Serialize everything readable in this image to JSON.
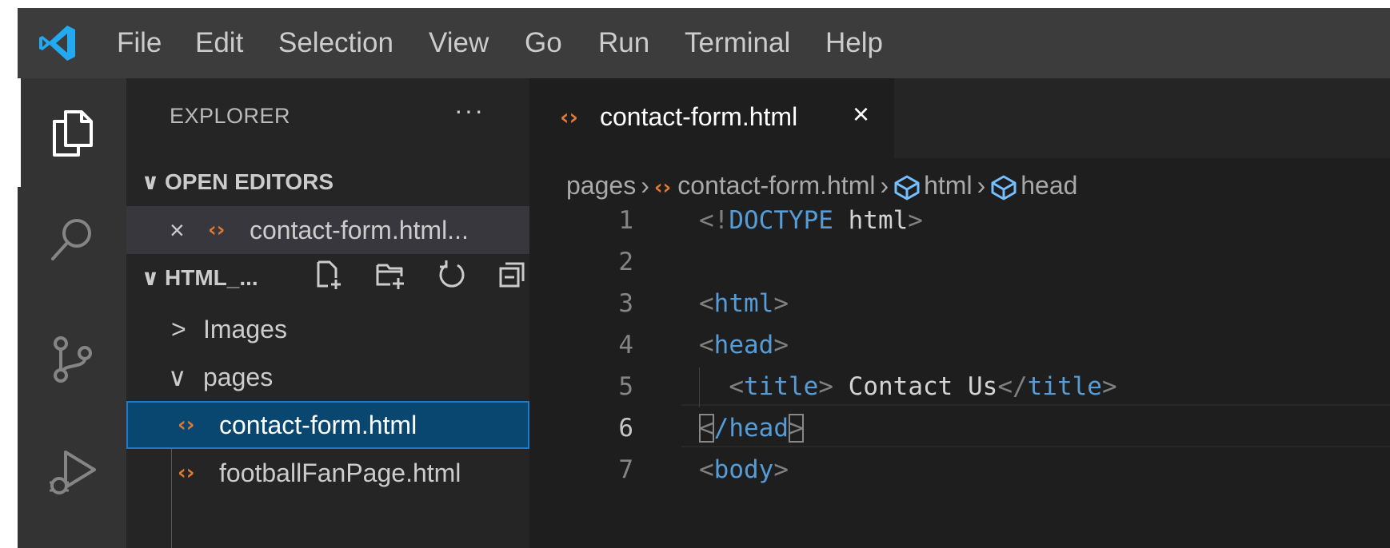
{
  "app": {
    "menu": [
      "File",
      "Edit",
      "Selection",
      "View",
      "Go",
      "Run",
      "Terminal",
      "Help"
    ]
  },
  "activity_bar": {
    "icons": [
      "explorer-icon",
      "search-icon",
      "source-control-icon",
      "run-debug-icon"
    ]
  },
  "sidebar": {
    "title": "EXPLORER",
    "more": "···",
    "open_editors": {
      "header": "OPEN EDITORS",
      "items": [
        {
          "close": "×",
          "label": "contact-form.html..."
        }
      ]
    },
    "workspace": {
      "header": "HTML_...",
      "toolbar_icons": [
        "new-file-icon",
        "new-folder-icon",
        "refresh-icon",
        "collapse-all-icon"
      ],
      "tree": [
        {
          "chevron": ">",
          "label": "Images"
        },
        {
          "chevron": "∨",
          "label": "pages"
        },
        {
          "label": "contact-form.html",
          "selected": true
        },
        {
          "label": "footballFanPage.html"
        }
      ]
    }
  },
  "editor": {
    "tab": {
      "label": "contact-form.html",
      "close": "×"
    },
    "breadcrumb": [
      "pages",
      "contact-form.html",
      "html",
      "head"
    ],
    "lines": [
      {
        "n": "1",
        "tokens": [
          [
            "punct",
            "<!"
          ],
          [
            "tag",
            "DOCTYPE "
          ],
          [
            "text",
            "html"
          ],
          [
            "punct",
            ">"
          ]
        ]
      },
      {
        "n": "2",
        "tokens": []
      },
      {
        "n": "3",
        "tokens": [
          [
            "punct",
            "<"
          ],
          [
            "tag",
            "html"
          ],
          [
            "punct",
            ">"
          ]
        ]
      },
      {
        "n": "4",
        "tokens": [
          [
            "punct",
            "<"
          ],
          [
            "tag",
            "head"
          ],
          [
            "punct",
            ">"
          ]
        ]
      },
      {
        "n": "5",
        "tokens": [
          [
            "text",
            "  "
          ],
          [
            "punct",
            "<"
          ],
          [
            "tag",
            "title"
          ],
          [
            "punct",
            ">"
          ],
          [
            "text",
            " Contact Us"
          ],
          [
            "punct",
            "</"
          ],
          [
            "tag",
            "title"
          ],
          [
            "punct",
            ">"
          ]
        ]
      },
      {
        "n": "6",
        "tokens": [
          [
            "punct",
            "<"
          ],
          [
            "tag",
            "/head"
          ],
          [
            "punct",
            ">"
          ]
        ],
        "current": true
      },
      {
        "n": "7",
        "tokens": [
          [
            "punct",
            "<"
          ],
          [
            "tag",
            "body"
          ],
          [
            "punct",
            ">"
          ]
        ]
      }
    ]
  },
  "colors": {
    "accent": "#007acc",
    "html_icon": "#e37933",
    "tag": "#569cd6",
    "selection": "#094771"
  }
}
